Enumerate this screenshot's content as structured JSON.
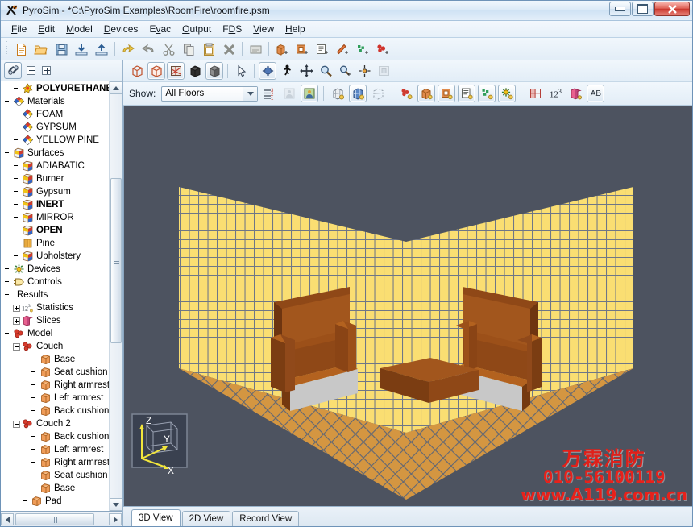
{
  "window": {
    "title": "PyroSim - *C:\\PyroSim Examples\\RoomFire\\roomfire.psm",
    "app_icon": "pyrosim-logo-icon",
    "minimize_label": "Minimize",
    "maximize_label": "Restore",
    "close_label": "Close"
  },
  "menu": {
    "items": [
      {
        "label": "File",
        "accel": "F"
      },
      {
        "label": "Edit",
        "accel": "E"
      },
      {
        "label": "Model",
        "accel": "M"
      },
      {
        "label": "Devices",
        "accel": "D"
      },
      {
        "label": "Evac",
        "accel": "v"
      },
      {
        "label": "Output",
        "accel": "O"
      },
      {
        "label": "FDS",
        "accel": "D"
      },
      {
        "label": "View",
        "accel": "V"
      },
      {
        "label": "Help",
        "accel": "H"
      }
    ]
  },
  "toolbar": {
    "buttons": [
      {
        "name": "new-icon",
        "title": "New"
      },
      {
        "name": "open-folder-icon",
        "title": "Open"
      },
      {
        "name": "save-icon",
        "title": "Save"
      },
      {
        "name": "import-icon",
        "title": "Import"
      },
      {
        "name": "export-icon",
        "title": "Export"
      },
      {
        "name": "undo-icon",
        "title": "Undo"
      },
      {
        "name": "redo-icon",
        "title": "Redo"
      },
      {
        "name": "cut-scissors-icon",
        "title": "Cut"
      },
      {
        "name": "copy-icon",
        "title": "Copy"
      },
      {
        "name": "paste-clipboard-icon",
        "title": "Paste"
      },
      {
        "name": "delete-x-icon",
        "title": "Delete"
      },
      {
        "name": "edit-note-icon",
        "title": "Edit"
      },
      {
        "name": "new-obstruction-icon",
        "title": "New Obstruction"
      },
      {
        "name": "new-hole-icon",
        "title": "New Hole"
      },
      {
        "name": "new-vent-icon",
        "title": "New Vent"
      },
      {
        "name": "new-slice-icon",
        "title": "New Slice"
      },
      {
        "name": "new-particles-icon",
        "title": "New Particles"
      },
      {
        "name": "new-reaction-icon",
        "title": "New Reaction"
      }
    ]
  },
  "tree_toolbar": {
    "toggle_name": "link-tree-icon",
    "collapse_all_name": "collapse-all-icon",
    "expand_all_name": "expand-all-icon"
  },
  "tree": {
    "nodes": [
      {
        "label": "POLYURETHANE",
        "icon": "reaction-icon",
        "indent": 1,
        "bold": true,
        "expander": "none"
      },
      {
        "label": "Materials",
        "icon": "material-icon",
        "indent": 0,
        "bold": false,
        "expander": "none"
      },
      {
        "label": "FOAM",
        "icon": "material-icon",
        "indent": 1,
        "bold": false,
        "expander": "none"
      },
      {
        "label": "GYPSUM",
        "icon": "material-icon",
        "indent": 1,
        "bold": false,
        "expander": "none"
      },
      {
        "label": "YELLOW PINE",
        "icon": "material-icon",
        "indent": 1,
        "bold": false,
        "expander": "none"
      },
      {
        "label": "Surfaces",
        "icon": "surface-icon",
        "indent": 0,
        "bold": false,
        "expander": "none"
      },
      {
        "label": "ADIABATIC",
        "icon": "surface-icon",
        "indent": 1,
        "bold": false,
        "expander": "none"
      },
      {
        "label": "Burner",
        "icon": "surface-icon",
        "indent": 1,
        "bold": false,
        "expander": "none"
      },
      {
        "label": "Gypsum",
        "icon": "surface-icon",
        "indent": 1,
        "bold": false,
        "expander": "none"
      },
      {
        "label": "INERT",
        "icon": "surface-icon",
        "indent": 1,
        "bold": true,
        "expander": "none"
      },
      {
        "label": "MIRROR",
        "icon": "surface-icon",
        "indent": 1,
        "bold": false,
        "expander": "none"
      },
      {
        "label": "OPEN",
        "icon": "surface-icon",
        "indent": 1,
        "bold": true,
        "expander": "none"
      },
      {
        "label": "Pine",
        "icon": "pine-icon",
        "indent": 1,
        "bold": false,
        "expander": "none"
      },
      {
        "label": "Upholstery",
        "icon": "surface-icon",
        "indent": 1,
        "bold": false,
        "expander": "none"
      },
      {
        "label": "Devices",
        "icon": "device-icon",
        "indent": 0,
        "bold": false,
        "expander": "none"
      },
      {
        "label": "Controls",
        "icon": "control-icon",
        "indent": 0,
        "bold": false,
        "expander": "none"
      },
      {
        "label": "Results",
        "icon": "none",
        "indent": 0,
        "bold": false,
        "expander": "none"
      },
      {
        "label": "Statistics",
        "icon": "statistics-icon",
        "indent": 1,
        "bold": false,
        "expander": "plus"
      },
      {
        "label": "Slices",
        "icon": "slices-icon",
        "indent": 1,
        "bold": false,
        "expander": "plus"
      },
      {
        "label": "Model",
        "icon": "model-icon",
        "indent": 0,
        "bold": false,
        "expander": "none"
      },
      {
        "label": "Couch",
        "icon": "model-icon",
        "indent": 1,
        "bold": false,
        "expander": "minus"
      },
      {
        "label": "Base",
        "icon": "obstruction-icon",
        "indent": 3,
        "bold": false,
        "expander": "none"
      },
      {
        "label": "Seat cushion",
        "icon": "obstruction-icon",
        "indent": 3,
        "bold": false,
        "expander": "none"
      },
      {
        "label": "Right armrest",
        "icon": "obstruction-icon",
        "indent": 3,
        "bold": false,
        "expander": "none"
      },
      {
        "label": "Left armrest",
        "icon": "obstruction-icon",
        "indent": 3,
        "bold": false,
        "expander": "none"
      },
      {
        "label": "Back cushion",
        "icon": "obstruction-icon",
        "indent": 3,
        "bold": false,
        "expander": "none"
      },
      {
        "label": "Couch 2",
        "icon": "model-icon",
        "indent": 1,
        "bold": false,
        "expander": "minus"
      },
      {
        "label": "Back cushion",
        "icon": "obstruction-icon",
        "indent": 3,
        "bold": false,
        "expander": "none"
      },
      {
        "label": "Left armrest",
        "icon": "obstruction-icon",
        "indent": 3,
        "bold": false,
        "expander": "none"
      },
      {
        "label": "Right armrest",
        "icon": "obstruction-icon",
        "indent": 3,
        "bold": false,
        "expander": "none"
      },
      {
        "label": "Seat cushion",
        "icon": "obstruction-icon",
        "indent": 3,
        "bold": false,
        "expander": "none"
      },
      {
        "label": "Base",
        "icon": "obstruction-icon",
        "indent": 3,
        "bold": false,
        "expander": "none"
      },
      {
        "label": "Pad",
        "icon": "obstruction-icon",
        "indent": 2,
        "bold": false,
        "expander": "none"
      }
    ]
  },
  "view_toolbar": {
    "buttons": [
      {
        "name": "wireframe-icon",
        "selected": false
      },
      {
        "name": "solid-outline-icon",
        "selected": true
      },
      {
        "name": "textured-icon",
        "selected": true
      },
      {
        "name": "solid-black-icon",
        "selected": false
      },
      {
        "name": "solid-shaded-icon",
        "selected": true
      },
      {
        "name": "select-arrow-icon",
        "selected": false
      },
      {
        "name": "orbit-icon",
        "selected": true
      },
      {
        "name": "walk-icon",
        "selected": false
      },
      {
        "name": "pan-icon",
        "selected": false
      },
      {
        "name": "zoom-icon",
        "selected": false
      },
      {
        "name": "zoom-region-icon",
        "selected": false
      },
      {
        "name": "set-center-icon",
        "selected": false
      },
      {
        "name": "zoom-fit-icon",
        "selected": false,
        "disabled": true
      }
    ]
  },
  "show_bar": {
    "label": "Show:",
    "floor_value": "All Floors",
    "floor_placeholder": "All Floors",
    "buttons": [
      {
        "name": "floor-list-icon"
      },
      {
        "name": "person-gray-icon",
        "disabled": true
      },
      {
        "name": "person-color-icon",
        "selected": true
      },
      {
        "name": "mesh-outline-icon"
      },
      {
        "name": "mesh-solid-icon",
        "selected": true
      },
      {
        "name": "mesh-hidden-icon"
      },
      {
        "name": "show-reaction-icon"
      },
      {
        "name": "show-obstructions-icon",
        "selected": true
      },
      {
        "name": "show-holes-icon",
        "selected": true
      },
      {
        "name": "show-vents-icon",
        "selected": true
      },
      {
        "name": "show-particles-icon",
        "selected": true
      },
      {
        "name": "show-devices-icon",
        "selected": true
      },
      {
        "name": "show-slices-icon"
      },
      {
        "name": "show-statistics-icon"
      },
      {
        "name": "show-planes-icon"
      },
      {
        "name": "show-labels-icon",
        "label": "AB"
      }
    ],
    "statistics_label": "12",
    "statistics_sup": "3",
    "labels_text": "AB"
  },
  "viewport": {
    "background_color": "#4d5360",
    "wall_color": "#fade72",
    "wall_grid_color": "#6b7385",
    "floor_color": "#d49641",
    "floor_grid_color": "#5f6675",
    "couch_color": "#8a4418",
    "couch_light_color": "#a8581f",
    "couch_base_color": "#cccccc",
    "axis_labels": {
      "x": "X",
      "y": "Y",
      "z": "Z"
    },
    "axis_color": "#f2e63c"
  },
  "tabs": {
    "items": [
      {
        "label": "3D View",
        "active": true
      },
      {
        "label": "2D View",
        "active": false
      },
      {
        "label": "Record View",
        "active": false
      }
    ]
  },
  "watermark": {
    "chinese": "万霖消防",
    "phone": "010-56100119",
    "url": "www.A119.com.cn",
    "color": "#e5201a"
  }
}
